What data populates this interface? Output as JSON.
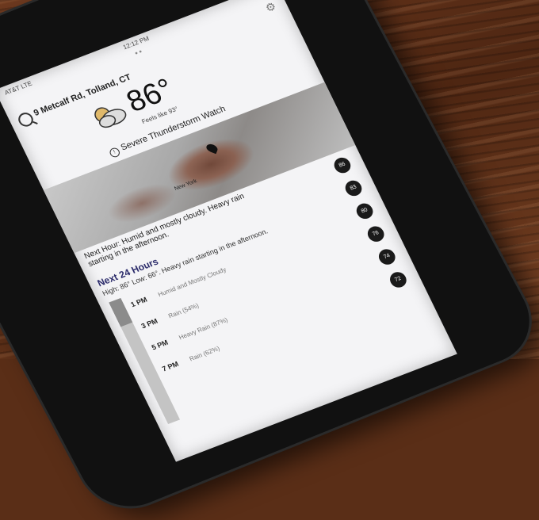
{
  "status": {
    "carrier": "AT&T LTE",
    "time": "12:12 PM"
  },
  "location": {
    "address": "9 Metcalf Rd, Tolland, CT"
  },
  "current": {
    "temperature": "86°",
    "feels_like": "Feels like 93°",
    "alert": "Severe Thunderstorm Watch"
  },
  "map": {
    "city_label": "New York"
  },
  "next_hour": "Next Hour: Humid and mostly cloudy. Heavy rain starting in the afternoon.",
  "forecast24": {
    "title": "Next 24 Hours",
    "hilo": "High: 86° Low: 66°. Heavy rain starting in the afternoon.",
    "precip_fill_fraction": 0.2,
    "rows": [
      {
        "time": "1 PM",
        "desc": "Humid and Mostly Cloudy"
      },
      {
        "time": "3 PM",
        "desc": "Rain (54%)"
      },
      {
        "time": "5 PM",
        "desc": "Heavy Rain (87%)"
      },
      {
        "time": "7 PM",
        "desc": "Rain (62%)"
      }
    ],
    "temps": [
      "86",
      "83",
      "80",
      "76",
      "74",
      "72"
    ]
  },
  "colors": {
    "screen": "#f4f4f6",
    "title": "#2a2a6a",
    "temp_circle": "#1a1a1a"
  }
}
